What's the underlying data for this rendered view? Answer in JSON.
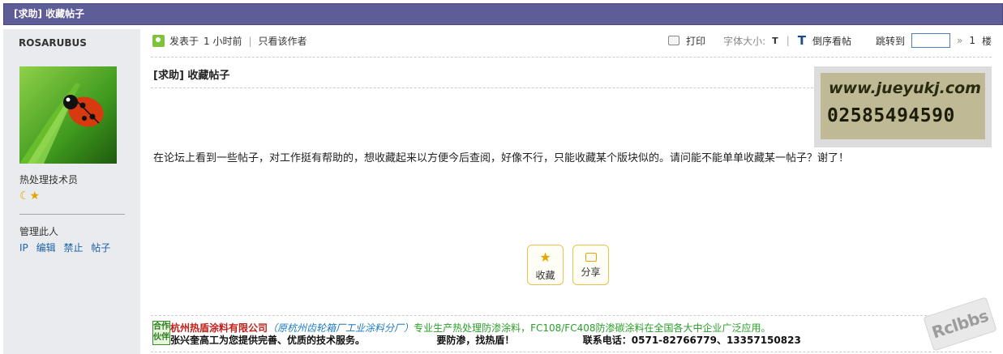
{
  "thread": {
    "header_title": "[求助] 收藏帖子",
    "title": "[求助] 收藏帖子"
  },
  "author": {
    "username": "ROSARUBUS",
    "rank": "热处理技术员",
    "stars": "☾★",
    "manage_label": "管理此人",
    "admin_links": [
      "IP",
      "编辑",
      "禁止",
      "帖子"
    ]
  },
  "meta": {
    "posted_prefix": "发表于",
    "posted_time": "1 小时前",
    "only_author": "只看该作者",
    "print": "打印",
    "font_size_label": "字体大小:",
    "font_small": "T",
    "font_big": "T",
    "reverse": "倒序看帖",
    "jump_label": "跳转到",
    "jump_value": "",
    "jump_arrow": "»",
    "floor_number": "1",
    "floor_unit": "楼"
  },
  "ad": {
    "url": "www.jueyukj.com",
    "phone": "02585494590"
  },
  "content": {
    "body": "在论坛上看到一些帖子，对工作挺有帮助的，想收藏起来以方便今后查阅，好像不行，只能收藏某个版块似的。请问能不能单单收藏某一帖子？谢了！"
  },
  "actions": {
    "favorite": "收藏",
    "share": "分享"
  },
  "signature": {
    "badge": "合作伙伴",
    "company": "杭州热盾涂料有限公司",
    "open_paren": "（",
    "original": "原杭州齿轮箱厂工业涂料分厂",
    "close_paren": "）",
    "desc": "专业生产热处理防渗涂料，FC108/FC408防渗碳涂料在全国各大中企业广泛应用。",
    "line2_a": "张兴奎高工为您提供完善、优质的技术服务。",
    "line2_b": "要防渗，找热盾！",
    "line2_c": "联系电话：0571-82766779、13357150823"
  },
  "watermark": "Rclbbs",
  "colors": {
    "header_bg": "#5f5d97",
    "sidebar_bg": "#e9ebef",
    "link_blue": "#1b62a8",
    "accent_gold": "#e8a500"
  }
}
